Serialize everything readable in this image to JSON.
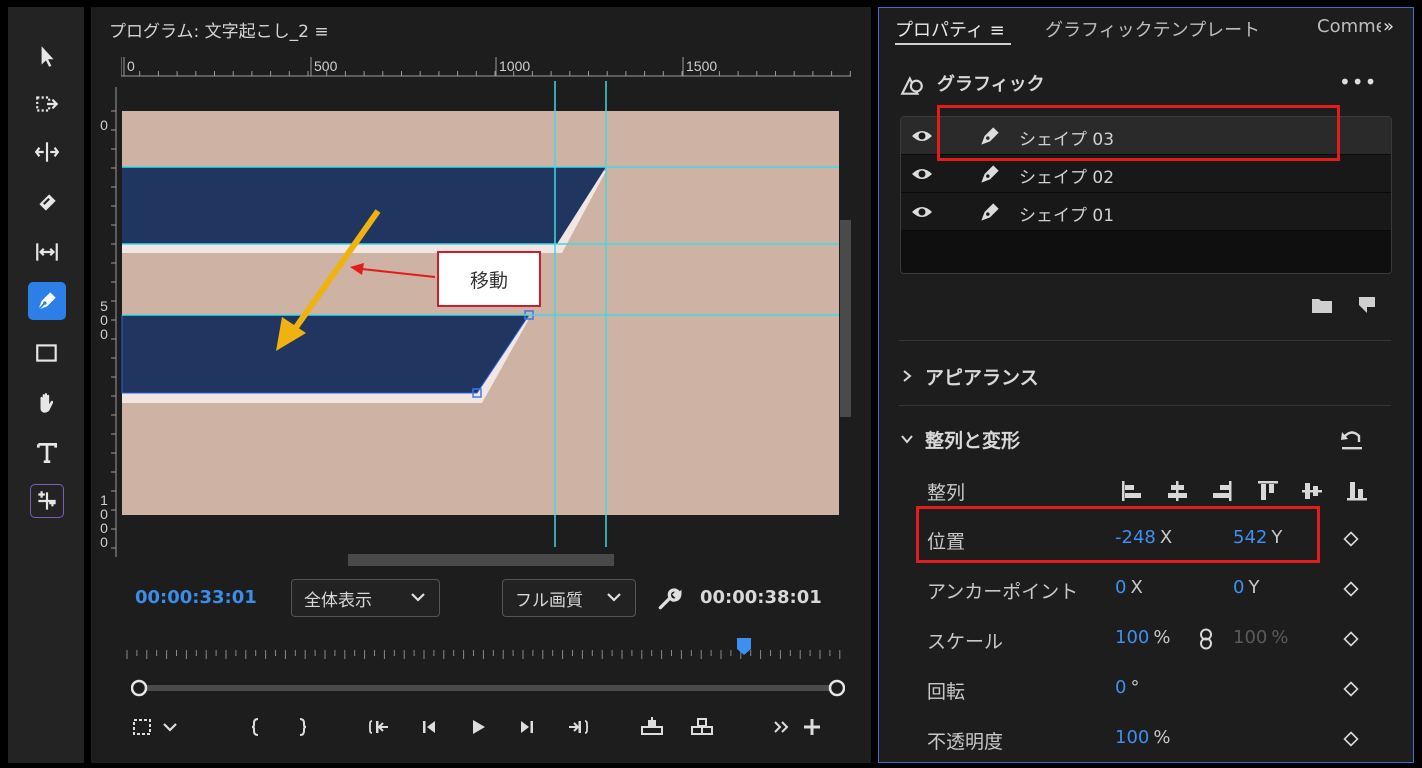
{
  "tools": {
    "items": [
      "selection-tool",
      "track-select-tool",
      "ripple-edit-tool",
      "razor-tool",
      "slip-tool",
      "pen-tool",
      "rectangle-tool",
      "hand-tool",
      "type-tool",
      "remix-tool"
    ],
    "active": "pen-tool"
  },
  "monitor": {
    "title": "プログラム: 文字起こし_2",
    "menu_icon": "≡",
    "ruler_h": [
      "0",
      "500",
      "1000",
      "1500"
    ],
    "ruler_v": [
      [
        "0"
      ],
      [
        "5",
        "0",
        "0"
      ],
      [
        "1",
        "0",
        "0",
        "0"
      ]
    ],
    "timecode_current": "00:00:33:01",
    "timecode_duration": "00:00:38:01",
    "zoom_select": "全体表示",
    "quality_select": "フル画質",
    "canvas_color": "#ceb2a3",
    "shape_color": "#213561",
    "guide_color": "#3fd9e6"
  },
  "annotation": {
    "callout_text": "移動",
    "arrow_color": "#f0b20f"
  },
  "properties": {
    "tabs": [
      "プロパティ",
      "グラフィックテンプレート",
      "Comme"
    ],
    "tab_menu_icon": "≡",
    "overflow": "»",
    "graphic_header": "グラフィック",
    "more_menu": "•••",
    "layers": [
      {
        "name": "シェイプ 03",
        "selected": true
      },
      {
        "name": "シェイプ 02",
        "selected": false
      },
      {
        "name": "シェイプ 01",
        "selected": false
      }
    ],
    "sections": {
      "appearance": "アピアランス",
      "align_transform": "整列と変形"
    },
    "align_label": "整列",
    "rows": {
      "position": {
        "label": "位置",
        "x": "-248",
        "x_unit": "X",
        "y": "542",
        "y_unit": "Y"
      },
      "anchor": {
        "label": "アンカーポイント",
        "x": "0",
        "x_unit": "X",
        "y": "0",
        "y_unit": "Y"
      },
      "scale": {
        "label": "スケール",
        "value": "100",
        "unit": "%",
        "value2": "100",
        "unit2": "%"
      },
      "rotation": {
        "label": "回転",
        "value": "0",
        "unit": "°"
      },
      "opacity": {
        "label": "不透明度",
        "value": "100",
        "unit": "%"
      }
    }
  }
}
